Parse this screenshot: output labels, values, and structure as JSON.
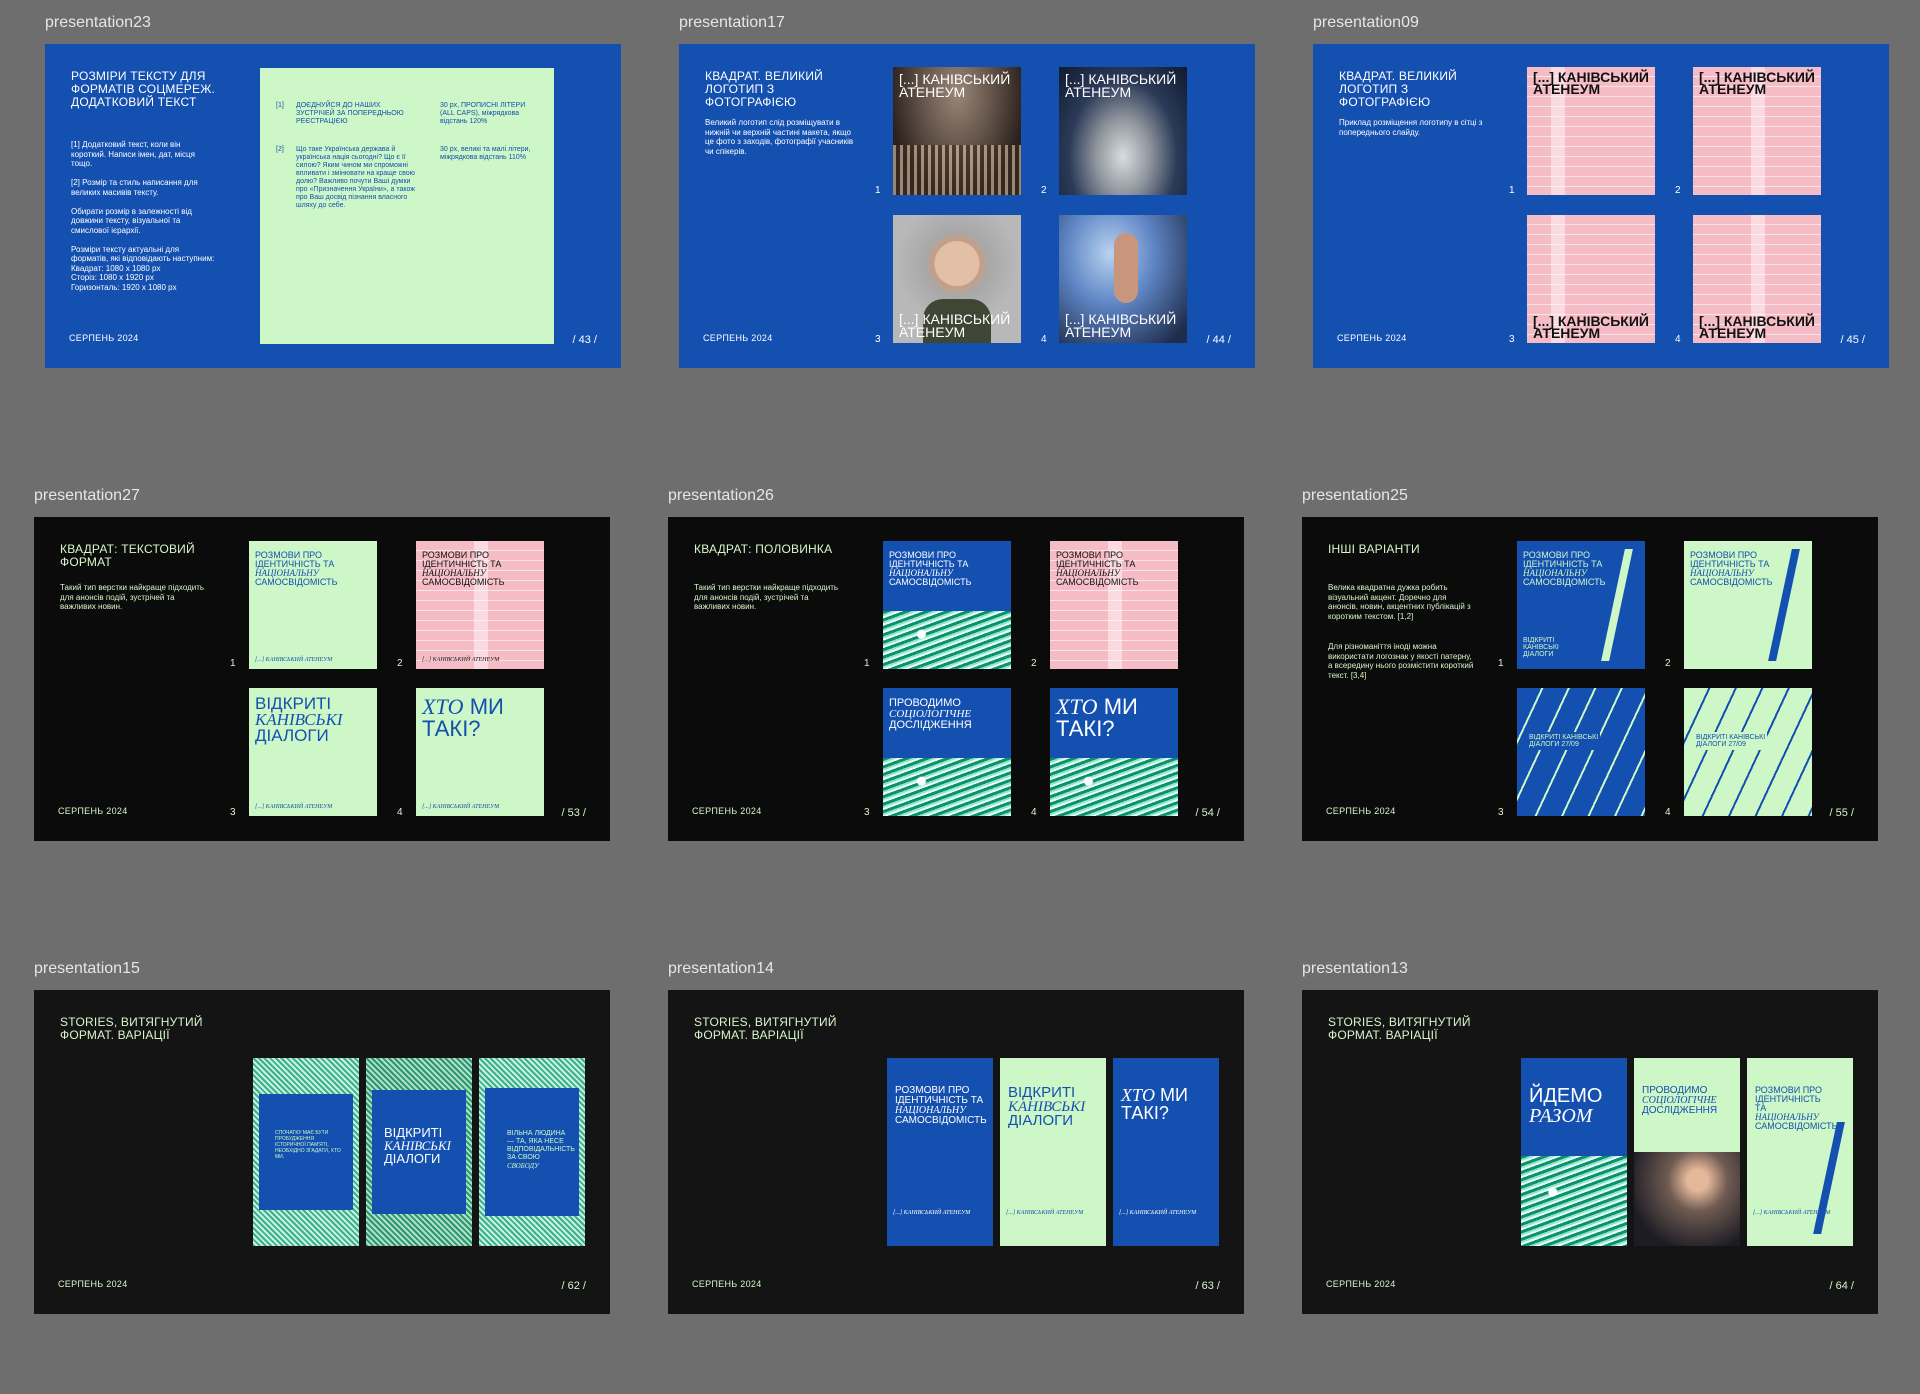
{
  "frames": {
    "f23": "presentation23",
    "f17": "presentation17",
    "f09": "presentation09",
    "f27": "presentation27",
    "f26": "presentation26",
    "f25": "presentation25",
    "f15": "presentation15",
    "f14": "presentation14",
    "f13": "presentation13"
  },
  "common": {
    "date": "СЕРПЕНЬ 2024"
  },
  "s23": {
    "title": "РОЗМІРИ ТЕКСТУ ДЛЯ ФОРМАТІВ СОЦМЕРЕЖ. ДОДАТКОВИЙ ТЕКСТ",
    "p1": "[1] Додатковий текст, коли він короткий. Написи імен, дат, місця тощо.",
    "p2": "[2] Розмір та стиль написання для великих масивів тексту.",
    "p3": "Обирати розмір в залежності від довжини тексту, візуальної та смислової ієрархії.",
    "p4": "Розміри тексту актуальні для форматів, які відповідають наступним:",
    "p5": "Квадрат: 1080 x 1080 px",
    "p6": "Сторіз: 1080 x 1920 px",
    "p7": "Горизонталь: 1920 x 1080 px",
    "n1": "[1]",
    "t1": "ДОЄДНУЙСЯ ДО НАШИХ ЗУСТРІЧЕЙ ЗА ПОПЕРЕДНЬОЮ РЕЄСТРАЦІЄЮ",
    "r1": "30 px, ПРОПИСНІ ЛІТЕРИ (ALL CAPS), міжрядкова відстань 120%",
    "n2": "[2]",
    "t2": "Що таке Українська держава й українська нація сьогодні? Що є її силою? Яким чином ми спроможні впливати і змінювати на краще свою долю? Важливо почути Ваші думки про «Призначення України», а також про Ваш досвід пізнання власного шляху до себе.",
    "r2": "30 px, великі та малі літери, міжрядкова відстань 110%",
    "page": "/ 43 /"
  },
  "s17": {
    "title": "КВАДРАТ. ВЕЛИКИЙ ЛОГОТИП З ФОТОГРАФІЄЮ",
    "body": "Великий логотип слід розміщувати в нижній чи верхній частині макета, якщо це фото з заходів, фотографії учасників чи спікерів.",
    "logo_a": "[...] КАНІВСЬКИЙ",
    "logo_b": "АТЕНЕУМ",
    "nums": [
      "1",
      "2",
      "3",
      "4"
    ],
    "page": "/ 44 /"
  },
  "s09": {
    "title": "КВАДРАТ. ВЕЛИКИЙ ЛОГОТИП З ФОТОГРАФІЄЮ",
    "body": "Приклад розміщення логотипу в сітці з попереднього слайду.",
    "logo_a": "[...] КАНІВСЬКИЙ",
    "logo_b": "АТЕНЕУМ",
    "nums": [
      "1",
      "2",
      "3",
      "4"
    ],
    "page": "/ 45 /"
  },
  "s27": {
    "title": "КВАДРАТ: ТЕКСТОВИЙ ФОРМАТ",
    "body": "Такий тип верстки найкраще підходить для анонсів подій, зустрічей та важливих новин.",
    "c1a": "РОЗМОВИ ПРО ІДЕНТИЧНІСТЬ ТА",
    "c1b": "НАЦІОНАЛЬНУ",
    "c1c": "САМОСВІДОМІСТЬ",
    "c3a": "ВІДКРИТІ",
    "c3b": "КАНІВСЬКІ",
    "c3c": "ДІАЛОГИ",
    "c4a": "ХТО",
    "c4b": "МИ ТАКІ?",
    "logo": "[...] КАНІВСЬКИЙ АТЕНЕУМ",
    "nums": [
      "1",
      "2",
      "3",
      "4"
    ],
    "page": "/ 53 /"
  },
  "s26": {
    "title": "КВАДРАТ: ПОЛОВИНКА",
    "body": "Такий тип верстки найкраще підходить для анонсів подій, зустрічей та важливих новин.",
    "c1a": "РОЗМОВИ ПРО ІДЕНТИЧНІСТЬ ТА",
    "c1b": "НАЦІОНАЛЬНУ",
    "c1c": "САМОСВІДОМІСТЬ",
    "c3a": "ПРОВОДИМО",
    "c3b": "СОЦІОЛОГІЧНЕ",
    "c3c": "ДОСЛІДЖЕННЯ",
    "c4a": "ХТО",
    "c4b": "МИ ТАКІ?",
    "nums": [
      "1",
      "2",
      "3",
      "4"
    ],
    "page": "/ 54 /"
  },
  "s25": {
    "title": "ІНШІ ВАРІАНТИ",
    "body1": "Велика квадратна дужка робить візуальний акцент. Доречно для анонсів, новин, акцентних публікацій з коротким текстом. [1,2]",
    "body2": "Для різноманіття іноді можна використати логознак у якості патерну, а всередину нього розмістити короткий текст. [3,4]",
    "c1a": "РОЗМОВИ ПРО ІДЕНТИЧНІСТЬ ТА",
    "c1b": "НАЦІОНАЛЬНУ",
    "c1c": "САМОСВІДОМІСТЬ",
    "c1d": "ВІДКРИТІ КАНІВСЬКІ ДІАЛОГИ",
    "c3a": "ВІДКРИТІ КАНІВСЬКІ",
    "c3b": "ДІАЛОГИ 27/09",
    "nums": [
      "1",
      "2",
      "3",
      "4"
    ],
    "page": "/ 55 /"
  },
  "s15": {
    "title": "STORIES, ВИТЯГНУТИЙ ФОРМАТ. ВАРІАЦІЇ",
    "a1": "СПОЧАТКУ МАЄ БУТИ ПРОБУДЖЕННЯ ІСТОРИЧНОЇ ПАМ'ЯТІ, НЕОБХІДНО ЗГАДАТИ, ХТО МИ.",
    "b1": "ВІДКРИТІ",
    "b2": "КАНІВСЬКІ",
    "b3": "ДІАЛОГИ",
    "c1": "ВІЛЬНА ЛЮДИНА — ТА, ЯКА НЕСЕ ВІДПОВІДАЛЬНІСТЬ ЗА СВОЮ",
    "c2": "СВОБОДУ",
    "page": "/ 62 /"
  },
  "s14": {
    "title": "STORIES, ВИТЯГНУТИЙ ФОРМАТ. ВАРІАЦІЇ",
    "a1": "РОЗМОВИ ПРО ІДЕНТИЧНІСТЬ ТА",
    "a2": "НАЦІОНАЛЬНУ",
    "a3": "САМОСВІДОМІСТЬ",
    "b1": "ВІДКРИТІ",
    "b2": "КАНІВСЬКІ",
    "b3": "ДІАЛОГИ",
    "c1": "ХТО",
    "c2": "МИ ТАКІ?",
    "logo": "[...] КАНІВСЬКИЙ АТЕНЕУМ",
    "page": "/ 63 /"
  },
  "s13": {
    "title": "STORIES, ВИТЯГНУТИЙ ФОРМАТ. ВАРІАЦІЇ",
    "a1": "ЙДЕМО",
    "a2": "РАЗОМ",
    "b1": "ПРОВОДИМО",
    "b2": "СОЦІОЛОГІЧНЕ",
    "b3": "ДОСЛІДЖЕННЯ",
    "c1": "РОЗМОВИ ПРО ІДЕНТИЧНІСТЬ ТА",
    "c2": "НАЦІОНАЛЬНУ",
    "c3": "САМОСВІДОМІСТЬ",
    "logo": "[...] КАНІВСЬКИЙ АТЕНЕУМ",
    "page": "/ 64 /"
  },
  "colors": {
    "blue": "#1450b0",
    "mint": "#cdf7c6",
    "pink": "#f6bcc6",
    "canvas": "#6e6e6e",
    "dark": "#0b0b0b"
  }
}
